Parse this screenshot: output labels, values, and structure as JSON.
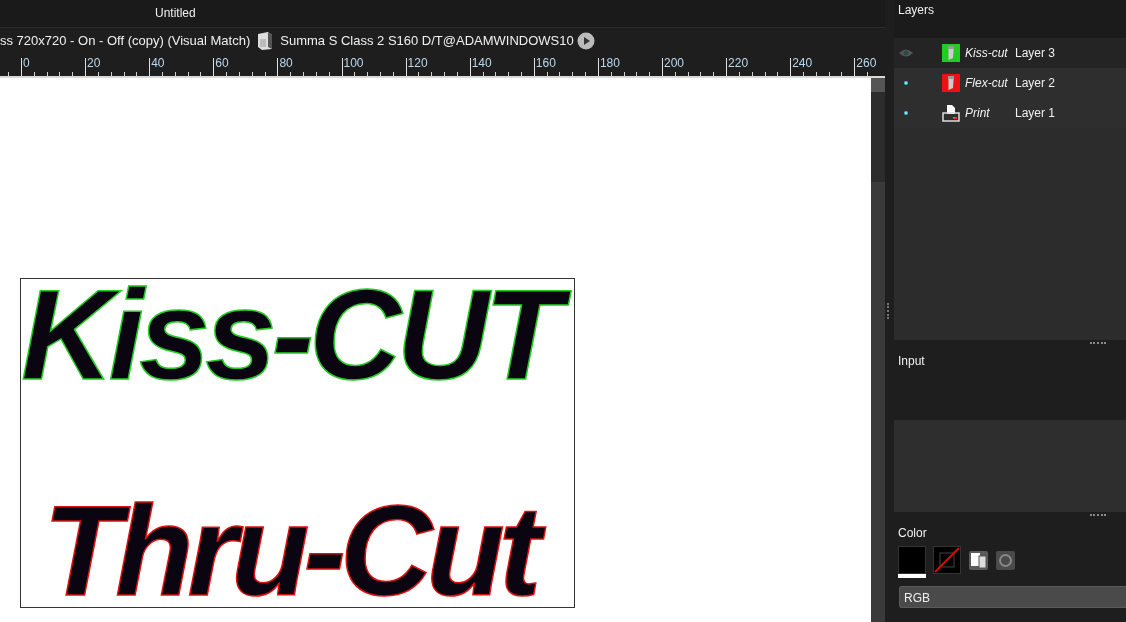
{
  "document_tab": {
    "title": "Untitled"
  },
  "job_bar": {
    "profile": "ss 720x720 - On - Off (copy) (Visual Match)",
    "device": "Summa S Class 2 S160 D/T@ADAMWINDOWS10"
  },
  "ruler": {
    "labels": [
      "0",
      "20",
      "40",
      "60",
      "80",
      "100",
      "120",
      "140",
      "160",
      "180",
      "200",
      "220",
      "240",
      "260"
    ]
  },
  "artwork": [
    {
      "text": "Kiss-CUT",
      "kind": "kisscut"
    },
    {
      "text": "Thru-Cut",
      "kind": "thrucut"
    }
  ],
  "layers_panel": {
    "title": "Layers",
    "layers": [
      {
        "kind": "cut",
        "color": "#22cc22",
        "method": "Kiss-cut",
        "name": "Layer 3",
        "selected": true
      },
      {
        "kind": "cut",
        "color": "#ee1111",
        "method": "Flex-cut",
        "name": "Layer 2",
        "selected": false
      },
      {
        "kind": "print",
        "method": "Print",
        "name": "Layer 1",
        "selected": false
      }
    ]
  },
  "input_panel": {
    "title": "Input"
  },
  "color_panel": {
    "title": "Color",
    "mode": "RGB"
  }
}
